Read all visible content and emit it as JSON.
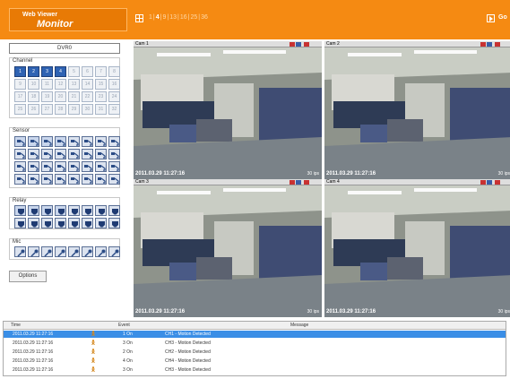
{
  "header": {
    "logo_line1": "Web Viewer",
    "logo_line2": "Monitor",
    "layouts": [
      "1",
      "4",
      "9",
      "13",
      "16",
      "25",
      "36"
    ],
    "go_label": "Go",
    "accent": "#f58a12"
  },
  "left_panel": {
    "device": "DVR0",
    "channel_title": "Channel",
    "channels": [
      "1",
      "2",
      "3",
      "4",
      "5",
      "6",
      "7",
      "8",
      "9",
      "10",
      "11",
      "12",
      "13",
      "14",
      "15",
      "16",
      "17",
      "18",
      "19",
      "20",
      "21",
      "22",
      "23",
      "24",
      "25",
      "26",
      "27",
      "28",
      "29",
      "30",
      "31",
      "32"
    ],
    "active_channels": 4,
    "sensor_title": "Sensor",
    "relay_title": "Relay",
    "mic_title": "Mic",
    "options_label": "Options"
  },
  "cameras": [
    {
      "name": "Cam 1",
      "timestamp": "2011.03.29 11:27:16",
      "fps": "30 ips"
    },
    {
      "name": "Cam 2",
      "timestamp": "2011.03.29 11:27:16",
      "fps": "30 ips"
    },
    {
      "name": "Cam 3",
      "timestamp": "2011.03.29 11:27:16",
      "fps": "30 ips"
    },
    {
      "name": "Cam 4",
      "timestamp": "2011.03.29 11:27:16",
      "fps": "30 ips"
    }
  ],
  "events": {
    "columns": [
      "Time",
      "Event",
      "Message"
    ],
    "rows": [
      {
        "time": "2011.03.29 11:27:16",
        "event": "1 On",
        "message": "CH1 - Motion Detected"
      },
      {
        "time": "2011.03.29 11:27:16",
        "event": "3 On",
        "message": "CH3 - Motion Detected"
      },
      {
        "time": "2011.03.29 11:27:16",
        "event": "2 On",
        "message": "CH2 - Motion Detected"
      },
      {
        "time": "2011.03.29 11:27:16",
        "event": "4 On",
        "message": "CH4 - Motion Detected"
      },
      {
        "time": "2011.03.29 11:27:16",
        "event": "3 On",
        "message": "CH3 - Motion Detected"
      }
    ]
  }
}
